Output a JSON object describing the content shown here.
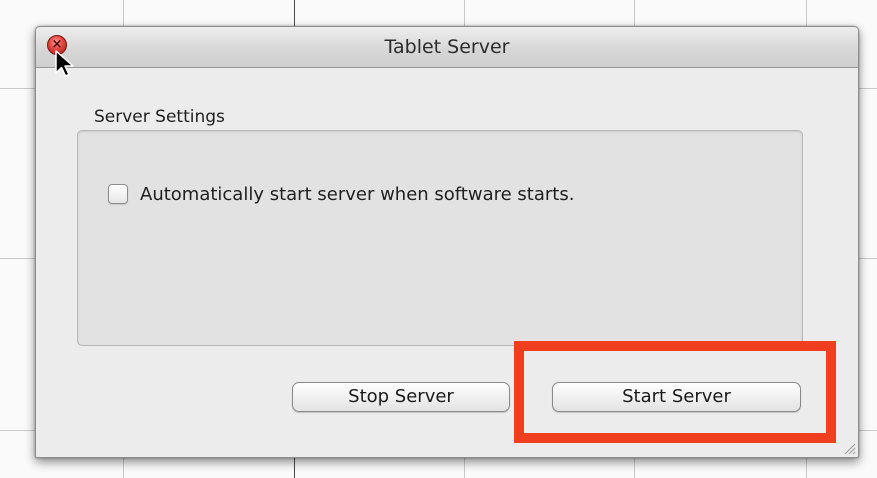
{
  "window": {
    "title": "Tablet Server",
    "close_glyph": "×"
  },
  "settings": {
    "section_label": "Server Settings",
    "auto_start": {
      "label": "Automatically start server when software starts.",
      "checked": false
    }
  },
  "buttons": {
    "stop_label": "Stop Server",
    "start_label": "Start Server"
  },
  "icons": {
    "close": "close-icon",
    "cursor": "cursor-icon",
    "resize": "resize-grip-icon"
  },
  "colors": {
    "highlight": "#f03f1f",
    "window_background": "#ececec",
    "close_button": "#e0453f"
  }
}
